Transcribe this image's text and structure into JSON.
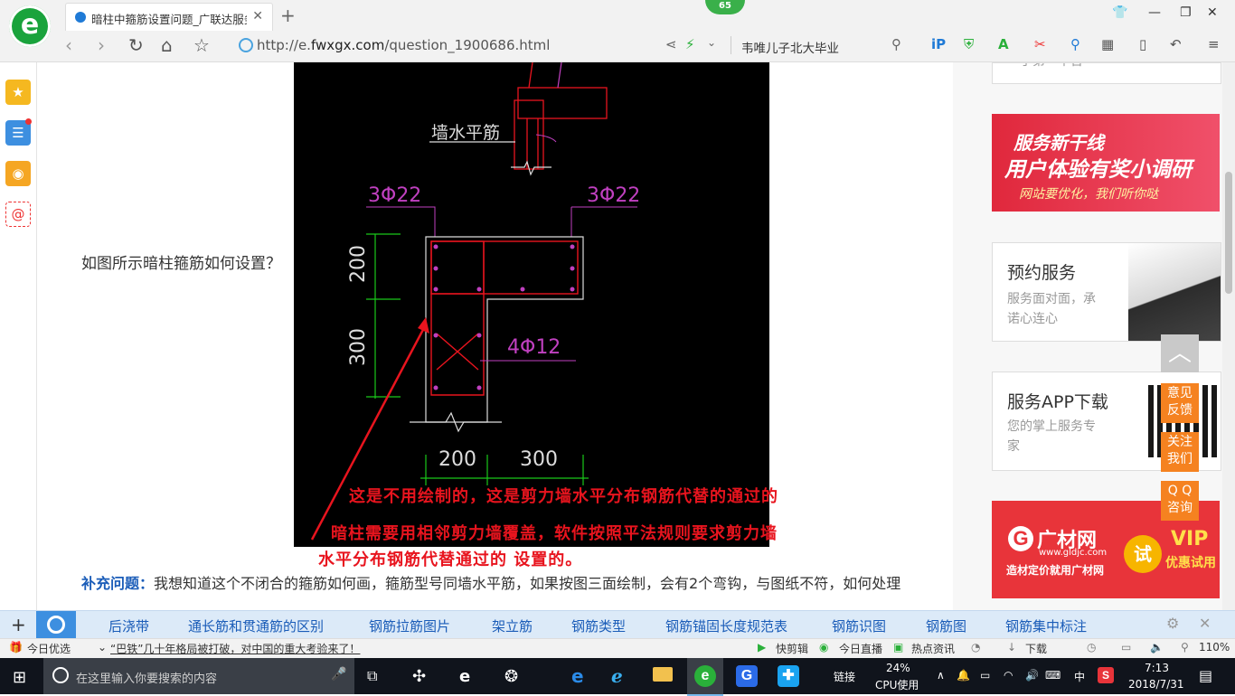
{
  "browser": {
    "tab_title": "暗柱中箍筋设置问题_广联达服务",
    "badge_count": "65",
    "url_prefix": "http://e.",
    "url_domain": "fwxgx.com",
    "url_path": "/question_1900686.html",
    "search_text": "韦唯儿子北大毕业"
  },
  "content": {
    "question": "如图所示暗柱箍筋如何设置？",
    "cad": {
      "wall_label": "墙水平筋",
      "rebar_left": "3Φ22",
      "rebar_right": "3Φ22",
      "rebar_mid": "4Φ12",
      "dim_200_v": "200",
      "dim_300_v": "300",
      "dim_200_h": "200",
      "dim_300_h": "300"
    },
    "annotation_lines": [
      "这是不用绘制的，这是剪力墙水平分布钢筋代替的通过的",
      "暗柱需要用相邻剪力墙覆盖，软件按照平法规则要求剪力墙",
      "水平分布钢筋代替通过的 设置的。"
    ],
    "supplement_label": "补充问题：",
    "supplement_text": "我想知道这个不闭合的箍筋如何画，箍筋型号同墙水平筋，如果按图三面绘制，会有2个弯钩，与图纸不符，如何处理"
  },
  "sidebar": {
    "top_partial": "一手第一平台",
    "banner1": {
      "line1": "服务新干线",
      "line2": "用户体验有奖小调研",
      "line3": "网站要优化，我们听你哒"
    },
    "card_reserve": {
      "title": "预约服务",
      "sub1": "服务面对面，承",
      "sub2": "诺心连心"
    },
    "card_app": {
      "title": "服务APP下载",
      "sub1": "您的掌上服务专",
      "sub2": "家"
    },
    "banner2": {
      "brand": "广材网",
      "site": "www.gldjc.com",
      "slogan": "造材定价就用广材网",
      "try": "试",
      "vip": "VIP",
      "vip_sub": "优惠试用"
    },
    "float": {
      "feedback": [
        "意见",
        "反馈"
      ],
      "follow": [
        "关注",
        "我们"
      ],
      "qq": [
        "Q Q",
        "咨询"
      ]
    }
  },
  "keywords": [
    "后浇带",
    "通长筋和贯通筋的区别",
    "钢筋拉筋图片",
    "架立筋",
    "钢筋类型",
    "钢筋锚固长度规范表",
    "钢筋识图",
    "钢筋图",
    "钢筋集中标注"
  ],
  "statusbar": {
    "today": "今日优选",
    "news": "“巴铁”几十年格局被打破，对中国的重大考验来了！",
    "quickclip": "快剪辑",
    "live": "今日直播",
    "hot": "热点资讯",
    "download": "下载",
    "zoom": "110%"
  },
  "taskbar": {
    "search_placeholder": "在这里输入你要搜索的内容",
    "link": "链接",
    "cpu_pct": "24%",
    "cpu_label": "CPU使用",
    "ime": "中",
    "time": "7:13",
    "date": "2018/7/31"
  },
  "colors": {
    "accent_blue": "#1a5cb8",
    "orange": "#f58220",
    "cad_magenta": "#c040c0",
    "cad_red": "#e8141e",
    "cad_green": "#19c819"
  }
}
